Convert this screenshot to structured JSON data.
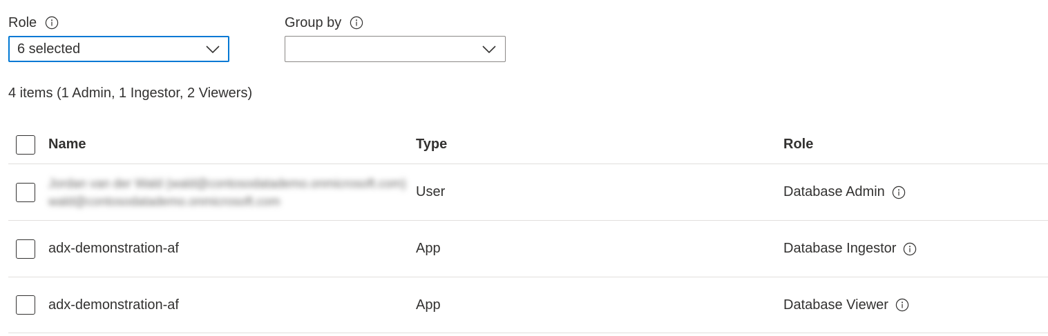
{
  "filters": {
    "role": {
      "label": "Role",
      "value": "6 selected"
    },
    "group_by": {
      "label": "Group by",
      "value": ""
    }
  },
  "summary": "4 items (1 Admin, 1 Ingestor, 2 Viewers)",
  "table": {
    "columns": [
      "Name",
      "Type",
      "Role"
    ],
    "rows": [
      {
        "name_line1": "Jordan van der Wald (wald@contosodatademo.onmicrosoft.com)",
        "name_line2": "wald@contosodatademo.onmicrosoft.com",
        "type": "User",
        "role": "Database Admin",
        "redacted": true
      },
      {
        "name": "adx-demonstration-af",
        "type": "App",
        "role": "Database Ingestor"
      },
      {
        "name": "adx-demonstration-af",
        "type": "App",
        "role": "Database Viewer"
      }
    ]
  },
  "icons": {
    "info": "info-circle-icon",
    "dropdown": "chevron-down-icon"
  },
  "colors": {
    "focus_border": "#0078d4",
    "text": "#323130",
    "divider": "#e1dfdd"
  }
}
